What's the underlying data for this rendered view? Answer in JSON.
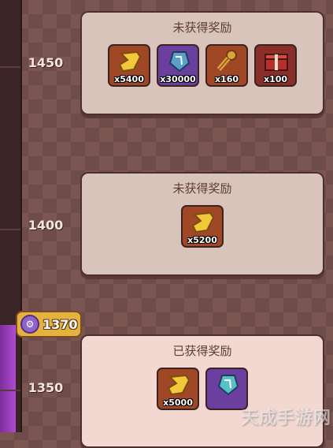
{
  "tiers": [
    {
      "score": "1450",
      "status": "未获得奖励",
      "rewards": [
        {
          "icon": "gold-scroll-icon",
          "qty": "x5400"
        },
        {
          "icon": "rune-crystal-icon",
          "qty": "x30000"
        },
        {
          "icon": "key-token-icon",
          "qty": "x160"
        },
        {
          "icon": "gift-box-icon",
          "qty": "x100"
        }
      ]
    },
    {
      "score": "1400",
      "status": "未获得奖励",
      "rewards": [
        {
          "icon": "gold-scroll-icon",
          "qty": "x5200"
        }
      ]
    },
    {
      "score": "1350",
      "status": "已获得奖励",
      "rewards": [
        {
          "icon": "gold-scroll-icon",
          "qty": "x5000"
        },
        {
          "icon": "rune-crystal-icon",
          "qty": ""
        }
      ]
    }
  ],
  "current_marker": {
    "icon": "gear-badge-icon",
    "value": "1370"
  },
  "watermark": "天成手游网"
}
